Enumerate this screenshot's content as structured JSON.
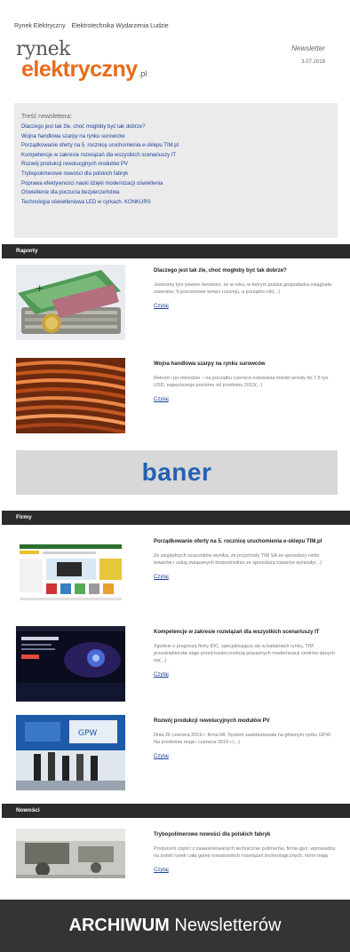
{
  "top_nav": [
    "Rynek Elektryczny",
    "Elektrotechnika Wydarzenia Ludzie"
  ],
  "logo": {
    "line1": "rynek",
    "line2": "elektryczny",
    "suffix": ".pl"
  },
  "newsletter": {
    "label": "Newsletter",
    "date": "3.07.2019"
  },
  "toc": {
    "heading": "Treść newslettera:",
    "items": [
      "Dlaczego jest tak źle, choć mogłoby być tak dobrze?",
      "Wojna handlowa szarpy na rynku surowców",
      "Porządkowanie oferty na 5. rocznicę uruchomienia e-sklepu TIM.pl",
      "Kompetencje w zakresie rozwiązań dla wszystkich scenariuszy IT",
      "Rozwój produkcji rewolucyjnych modułów PV",
      "Trybopolimerowe nowości dla polskich fabryk",
      "Poprawa efektywności nauki dzięki modernizacji oświetlenia",
      "Oświetlenie dla poczucia bezpieczeństwa",
      "Technologia oświetleniowa LED w cyrkach. KONKURS"
    ]
  },
  "sections": {
    "raporty": "Raporty",
    "firmy": "Firmy",
    "nowosci": "Nowości"
  },
  "articles": [
    {
      "title": "Dlaczego jest tak źle, choć mogłoby być tak dobrze?",
      "desc": "Jesteśmy tym pewien fenomen, że w roku, w którym polska gospodarka osiągnęła zawrotne, 5-procentowe tempo rozwoju, a porządni rok(...)",
      "link": "Czytaj"
    },
    {
      "title": "Wojna handlowa szarpy na rynku surowców",
      "desc": "Rekord i po rekordzie – na początku czerwca notowania miedzi wrosły do 7,5 tys. USD, najwyższego poziomu od przełomu 2013(...)",
      "link": "Czytaj"
    },
    {
      "title": "Porządkowanie oferty na 5. rocznicę uruchomienia e-sklepu TIM.pl",
      "desc": "Ze względnych szacunków wynika, że przychody TIM SA ze sprzedaży netto towarów i usług związanych bezpośrednio ze sprzedażą towarów wyniosły(...)",
      "link": "Czytaj"
    },
    {
      "title": "Kompetencje w zakresie rozwiązań dla wszystkich scenariuszy IT",
      "desc": "Zgodnie z prognozą firmy IDC, specjalizującej się w badaniach rynku, TIM przedsiębiorstw staje przed koniecznością poważnych modernizacji centrów danych na(...)",
      "link": "Czytaj"
    },
    {
      "title": "Rozwój produkcji rewolucyjnych modułów PV",
      "desc": "Dnia 26 czerwca 2019 r. firma ML System zadebiutowała na głównym rynku GPW. Na przełomie maja i czerwca 2019 r.(...)",
      "link": "Czytaj"
    },
    {
      "title": "Trybopolimerowe nowości dla polskich fabryk",
      "desc": "Producent części z zaawansowanych technicznie polimerów, firma igus, wprowadza na polski rynek całą gamę nowatorskich rozwiązań technologicznych, które mają",
      "link": "Czytaj"
    }
  ],
  "banner": "baner",
  "archive": {
    "bold": "ARCHIWUM",
    "rest": " Newsletterów"
  },
  "colors": {
    "accent_orange": "#e96b1a",
    "link_blue": "#1a3f9c",
    "section_bar": "#2b2b2b",
    "banner_blue": "#2461b3"
  }
}
